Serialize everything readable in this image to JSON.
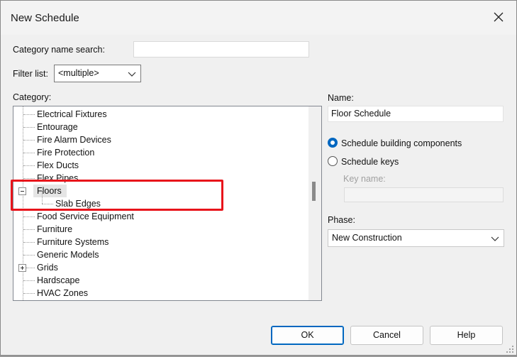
{
  "dialog": {
    "title": "New Schedule"
  },
  "search": {
    "label": "Category name search:",
    "value": ""
  },
  "filter": {
    "label": "Filter list:",
    "value": "<multiple>"
  },
  "category": {
    "label": "Category:",
    "items": [
      {
        "label": "Electrical Fixtures"
      },
      {
        "label": "Entourage"
      },
      {
        "label": "Fire Alarm Devices"
      },
      {
        "label": "Fire Protection"
      },
      {
        "label": "Flex Ducts"
      },
      {
        "label": "Flex Pipes"
      },
      {
        "label": "Floors"
      },
      {
        "label": "Slab Edges"
      },
      {
        "label": "Food Service Equipment"
      },
      {
        "label": "Furniture"
      },
      {
        "label": "Furniture Systems"
      },
      {
        "label": "Generic Models"
      },
      {
        "label": "Grids"
      },
      {
        "label": "Hardscape"
      },
      {
        "label": "HVAC Zones"
      }
    ]
  },
  "name": {
    "label": "Name:",
    "value": "Floor Schedule"
  },
  "options": {
    "building_components": "Schedule building components",
    "schedule_keys": "Schedule keys",
    "key_name_label": "Key name:",
    "key_name_value": ""
  },
  "phase": {
    "label": "Phase:",
    "value": "New Construction"
  },
  "buttons": {
    "ok": "OK",
    "cancel": "Cancel",
    "help": "Help"
  },
  "colors": {
    "accent": "#0067c0",
    "highlight_box": "#e8141b"
  }
}
